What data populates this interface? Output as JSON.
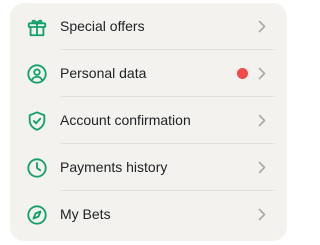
{
  "theme": {
    "card_background": "#f3f2ee",
    "icon_color": "#14a06a",
    "text_color": "#202326",
    "chevron_color": "#a8a8a5",
    "alert_dot_color": "#f24a4a"
  },
  "menu": {
    "items": [
      {
        "label": "Special offers",
        "icon": "gift-icon",
        "has_alert": false
      },
      {
        "label": "Personal data",
        "icon": "user-circle-icon",
        "has_alert": true
      },
      {
        "label": "Account confirmation",
        "icon": "shield-check-icon",
        "has_alert": false
      },
      {
        "label": "Payments history",
        "icon": "clock-icon",
        "has_alert": false
      },
      {
        "label": "My Bets",
        "icon": "compass-icon",
        "has_alert": false
      }
    ]
  }
}
